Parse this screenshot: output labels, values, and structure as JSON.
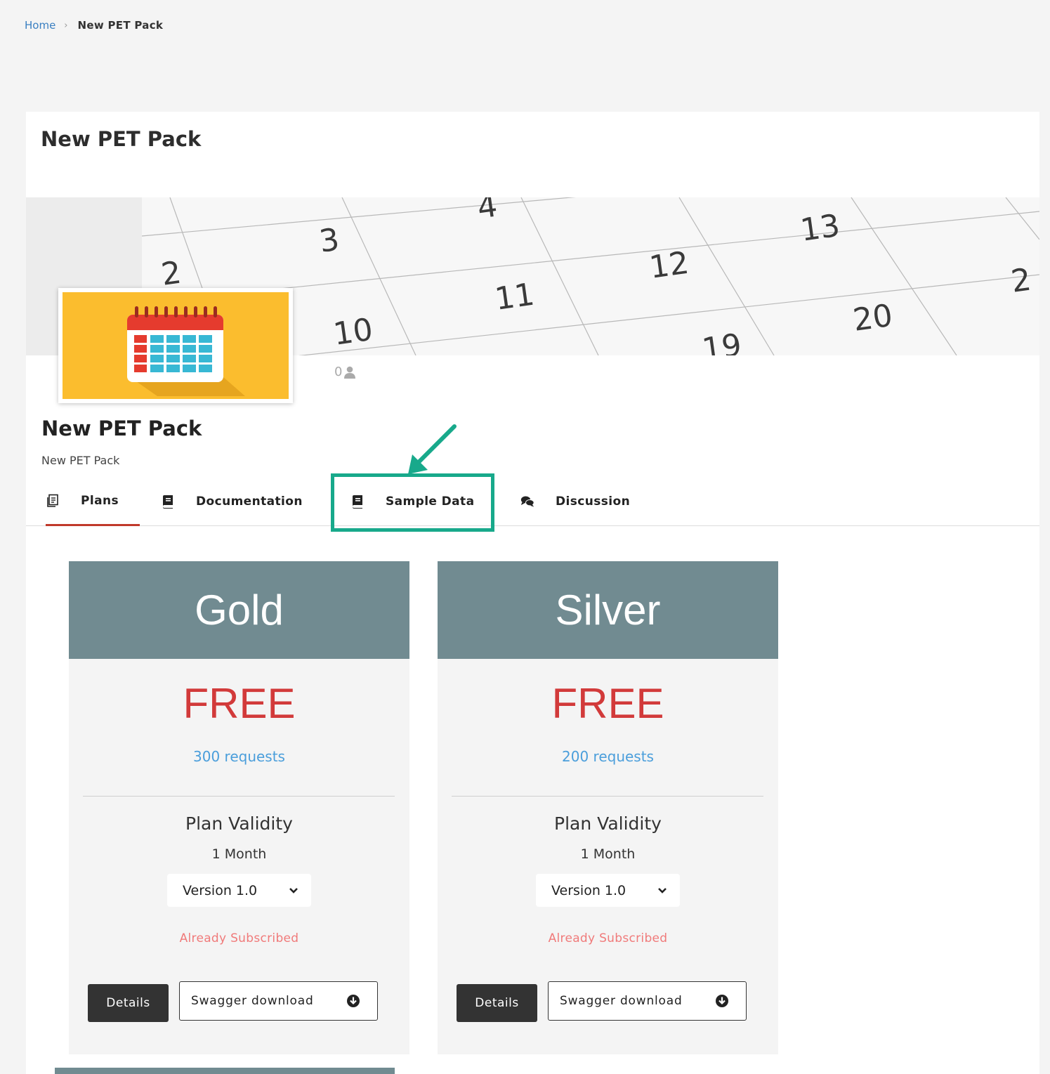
{
  "breadcrumb": {
    "home": "Home",
    "current": "New PET Pack"
  },
  "page": {
    "title": "New PET Pack"
  },
  "banner": {
    "calendar_numbers": [
      "2",
      "3",
      "4",
      "10",
      "11",
      "12",
      "13",
      "19",
      "20",
      "2"
    ]
  },
  "product": {
    "subscriber_count": "0",
    "name": "New PET Pack",
    "description": "New PET Pack"
  },
  "tabs": [
    {
      "label": "Plans",
      "icon": "copy-icon",
      "active": true
    },
    {
      "label": "Documentation",
      "icon": "book-icon"
    },
    {
      "label": "Sample Data",
      "icon": "book-icon"
    },
    {
      "label": "Discussion",
      "icon": "comments-icon"
    }
  ],
  "plans": [
    {
      "name": "Gold",
      "price": "FREE",
      "requests": "300 requests",
      "validity_label": "Plan Validity",
      "validity_value": "1 Month",
      "version": "Version 1.0",
      "status": "Already Subscribed",
      "details_label": "Details",
      "swagger_label": "Swagger download"
    },
    {
      "name": "Silver",
      "price": "FREE",
      "requests": "200 requests",
      "validity_label": "Plan Validity",
      "validity_value": "1 Month",
      "version": "Version 1.0",
      "status": "Already Subscribed",
      "details_label": "Details",
      "swagger_label": "Swagger download"
    }
  ],
  "colors": {
    "accent_red": "#c0392b",
    "highlight": "#18a98b",
    "plan_header": "#718b91",
    "price": "#d23a3a",
    "requests": "#4a9edb",
    "subscribed": "#f07a7a"
  }
}
